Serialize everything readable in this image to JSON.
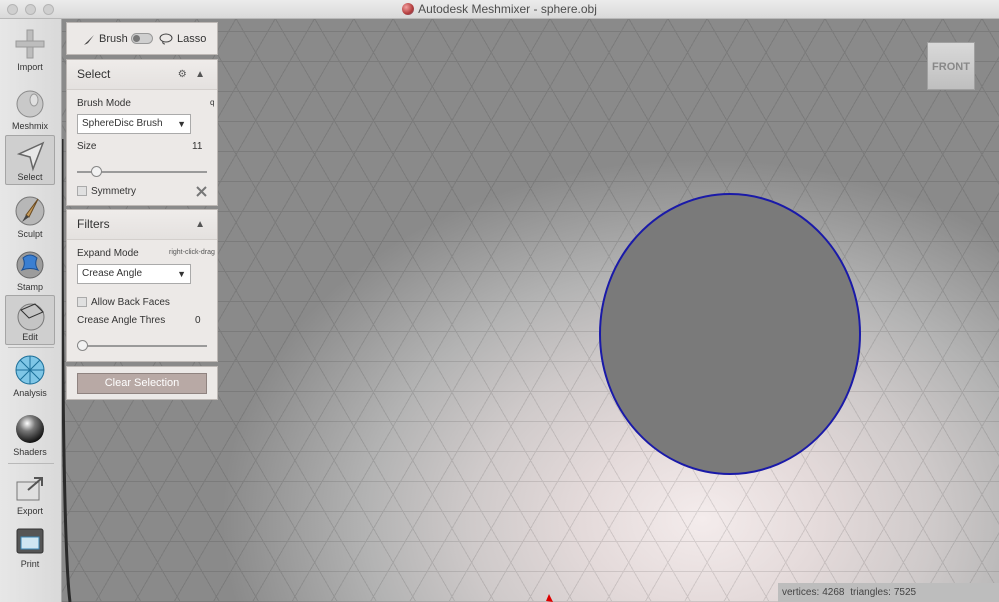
{
  "window": {
    "title": "Autodesk Meshmixer - sphere.obj"
  },
  "toolbar": {
    "items": [
      {
        "label": "Import",
        "icon": "plus-icon"
      },
      {
        "label": "Meshmix",
        "icon": "bunny-icon"
      },
      {
        "label": "Select",
        "icon": "arrow-cursor-icon"
      },
      {
        "label": "Sculpt",
        "icon": "brush-icon"
      },
      {
        "label": "Stamp",
        "icon": "stamp-icon"
      },
      {
        "label": "Edit",
        "icon": "edit-cube-icon"
      },
      {
        "label": "Analysis",
        "icon": "mesh-sphere-icon"
      },
      {
        "label": "Shaders",
        "icon": "shader-sphere-icon"
      },
      {
        "label": "Export",
        "icon": "export-icon"
      },
      {
        "label": "Print",
        "icon": "printer-icon"
      }
    ],
    "active": "Select"
  },
  "brushbar": {
    "brush_label": "Brush",
    "lasso_label": "Lasso"
  },
  "select_panel": {
    "title": "Select",
    "brush_mode_label": "Brush Mode",
    "brush_mode_hotkey": "q",
    "brush_mode_value": "SphereDisc Brush",
    "size_label": "Size",
    "size_value": "11",
    "size_level": 0.12,
    "symmetry_label": "Symmetry"
  },
  "filters_panel": {
    "title": "Filters",
    "expand_mode_label": "Expand Mode",
    "expand_mode_hint": "right-click-drag",
    "expand_mode_value": "Crease Angle",
    "allow_back_faces_label": "Allow Back Faces",
    "crease_label": "Crease Angle Thres",
    "crease_value": "0",
    "crease_level": 0.0
  },
  "clear_selection_label": "Clear Selection",
  "viewcube_label": "FRONT",
  "status": {
    "vertices_label": "vertices:",
    "vertices": "4268",
    "triangles_label": "triangles:",
    "triangles": "7525"
  },
  "colors": {
    "selection_outline": "#1a1aa8",
    "selection_fill": "#7a7a7a",
    "panel_bg": "#ece9e7",
    "button_bg": "#b8a9a5"
  }
}
